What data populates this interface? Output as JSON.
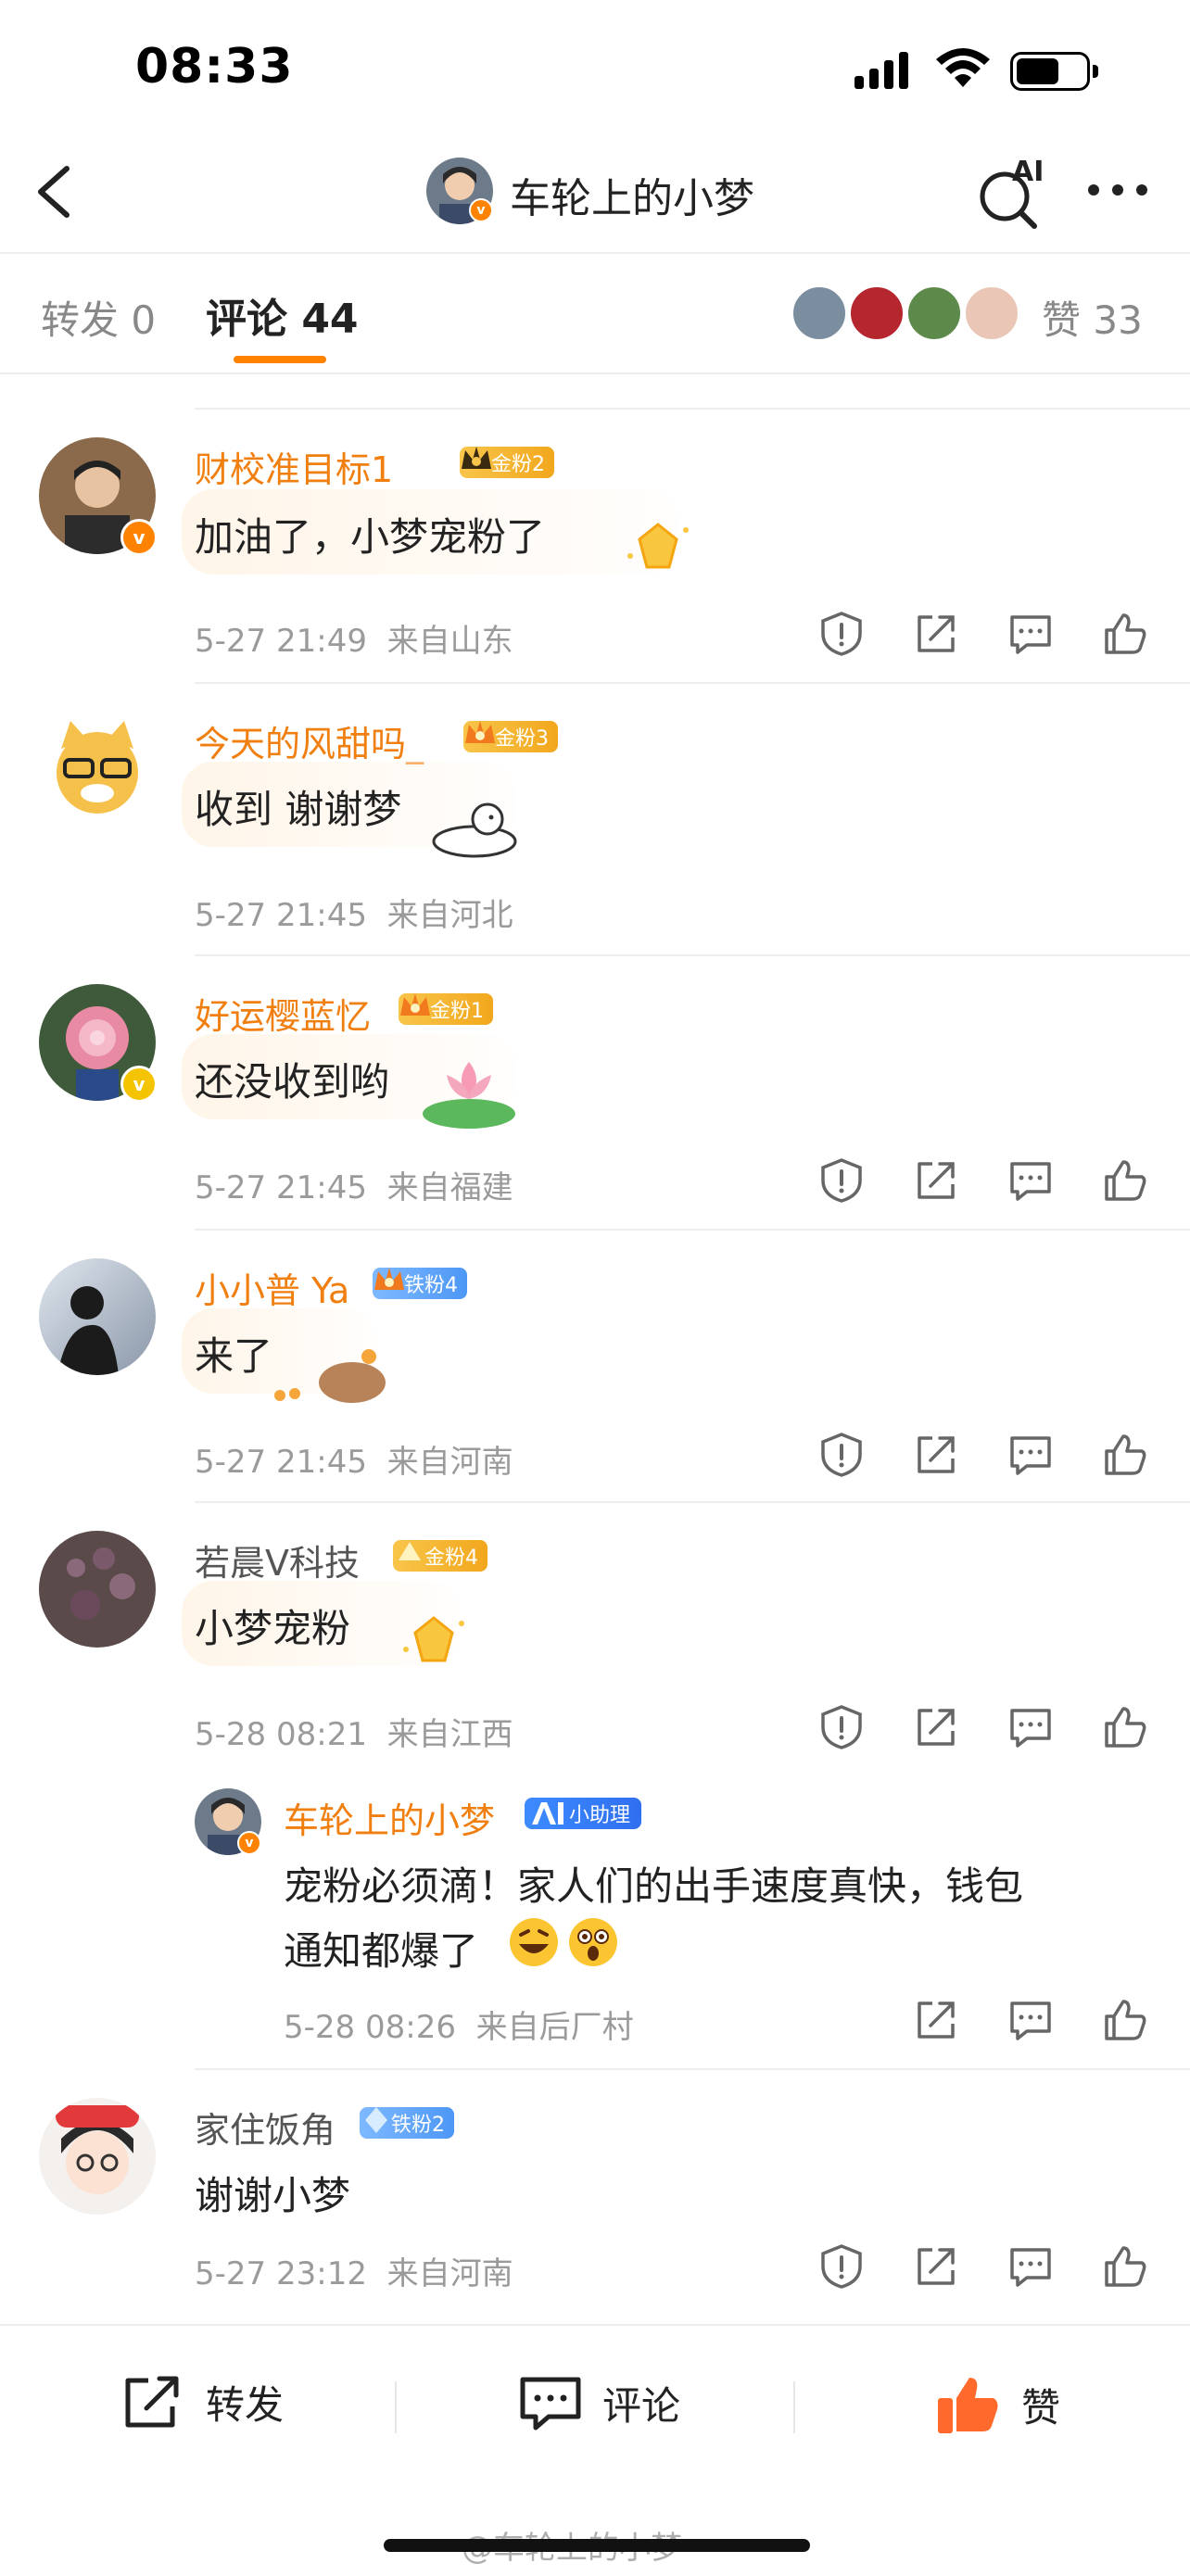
{
  "status_bar": {
    "time": "08:33",
    "battery_percent": 0.62
  },
  "nav": {
    "title": "车轮上的小梦",
    "ai_label": "AI"
  },
  "tabs": {
    "repost": "转发 0",
    "comment": "评论 44",
    "likes": "赞 33"
  },
  "comments": [
    {
      "user": "财校准目标1",
      "badge": "金粉2",
      "text": "加油了，小梦宠粉了",
      "time": "5-27 21:49",
      "location": "来自山东"
    },
    {
      "user": "今天的风甜吗_",
      "badge": "金粉3",
      "text": "收到 谢谢梦",
      "time": "5-27 21:45",
      "location": "来自河北"
    },
    {
      "user": "好运樱蓝忆",
      "badge": "金粉1",
      "text": "还没收到哟",
      "time": "5-27 21:45",
      "location": "来自福建"
    },
    {
      "user": "小小普 Ya",
      "badge": "铁粉4",
      "text": "来了",
      "time": "5-27 21:45",
      "location": "来自河南"
    },
    {
      "user": "若晨Ⅴ科技",
      "badge": "金粉4",
      "text": "小梦宠粉",
      "time": "5-28 08:21",
      "location": "来自江西"
    },
    {
      "user": "家住饭角",
      "badge": "铁粉2",
      "text": "谢谢小梦",
      "time": "5-27 23:12",
      "location": "来自河南"
    }
  ],
  "reply": {
    "user": "车轮上的小梦",
    "badge": "小助理",
    "text_line1": "宠粉必须滴！家人们的出手速度真快，钱包",
    "text_line2": "通知都爆了",
    "time": "5-28 08:26",
    "location": "来自后厂村"
  },
  "bottom_bar": {
    "repost": "转发",
    "comment": "评论",
    "like": "赞"
  },
  "watermark": "@车轮上的小梦",
  "colors": {
    "accent": "#ff8200",
    "username": "#f07f10",
    "like_active": "#ff6a2c"
  }
}
